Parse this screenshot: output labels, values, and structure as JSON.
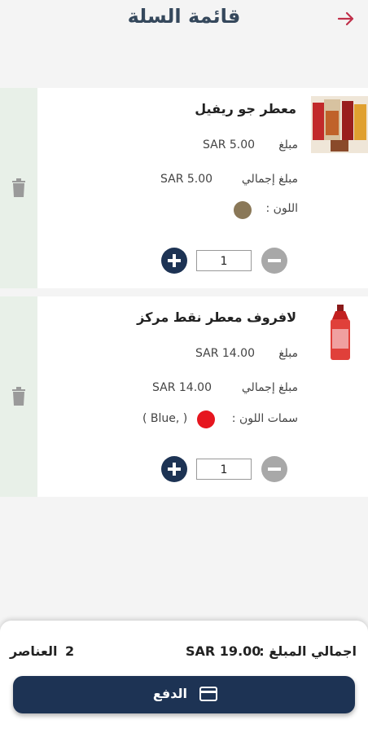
{
  "header": {
    "title": "قائمة السلة",
    "back_icon": "arrow-right-icon",
    "back_color": "#c0304a"
  },
  "items": [
    {
      "name": "معطر جو ريفيل",
      "price_label": "مبلغ",
      "price": "SAR 5.00",
      "total_label": "مبلغ إجمالي",
      "total": "SAR 5.00",
      "color_label": "اللون :",
      "color_hex": "#8a7858",
      "color_text": "",
      "quantity": "1"
    },
    {
      "name": "لافروف معطر نقط مركز",
      "price_label": "مبلغ",
      "price": "SAR 14.00",
      "total_label": "مبلغ إجمالي",
      "total": "SAR 14.00",
      "color_label": "سمات اللون :",
      "color_hex": "#e6161f",
      "color_text": "( Blue, )",
      "quantity": "1"
    }
  ],
  "footer": {
    "total_label": "اجمالي المبلغ :",
    "total_value": "SAR 19.00",
    "count": "2",
    "count_label": "العناصر",
    "pay_label": "الدفع"
  },
  "colors": {
    "primary": "#1d3354",
    "minus": "#a8a8a8",
    "strip": "#e8f0e8"
  }
}
